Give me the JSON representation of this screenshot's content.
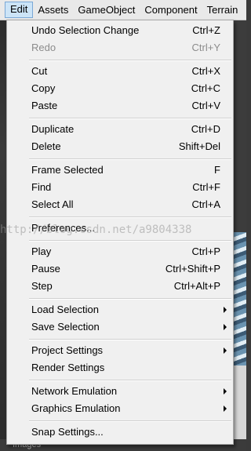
{
  "menubar": {
    "items": [
      "Edit",
      "Assets",
      "GameObject",
      "Component",
      "Terrain"
    ]
  },
  "edit_menu": {
    "undo": {
      "label": "Undo Selection Change",
      "shortcut": "Ctrl+Z"
    },
    "redo": {
      "label": "Redo",
      "shortcut": "Ctrl+Y"
    },
    "cut": {
      "label": "Cut",
      "shortcut": "Ctrl+X"
    },
    "copy": {
      "label": "Copy",
      "shortcut": "Ctrl+C"
    },
    "paste": {
      "label": "Paste",
      "shortcut": "Ctrl+V"
    },
    "duplicate": {
      "label": "Duplicate",
      "shortcut": "Ctrl+D"
    },
    "delete": {
      "label": "Delete",
      "shortcut": "Shift+Del"
    },
    "frame_selected": {
      "label": "Frame Selected",
      "shortcut": "F"
    },
    "find": {
      "label": "Find",
      "shortcut": "Ctrl+F"
    },
    "select_all": {
      "label": "Select All",
      "shortcut": "Ctrl+A"
    },
    "preferences": {
      "label": "Preferences..."
    },
    "play": {
      "label": "Play",
      "shortcut": "Ctrl+P"
    },
    "pause": {
      "label": "Pause",
      "shortcut": "Ctrl+Shift+P"
    },
    "step": {
      "label": "Step",
      "shortcut": "Ctrl+Alt+P"
    },
    "load_selection": {
      "label": "Load Selection"
    },
    "save_selection": {
      "label": "Save Selection"
    },
    "project_settings": {
      "label": "Project Settings"
    },
    "render_settings": {
      "label": "Render Settings"
    },
    "network_emulation": {
      "label": "Network Emulation"
    },
    "graphics_emulation": {
      "label": "Graphics Emulation"
    },
    "snap_settings": {
      "label": "Snap Settings..."
    }
  },
  "watermark": "http://blog.csdn.net/a9804338",
  "bottom_panel": {
    "label": "Images"
  }
}
